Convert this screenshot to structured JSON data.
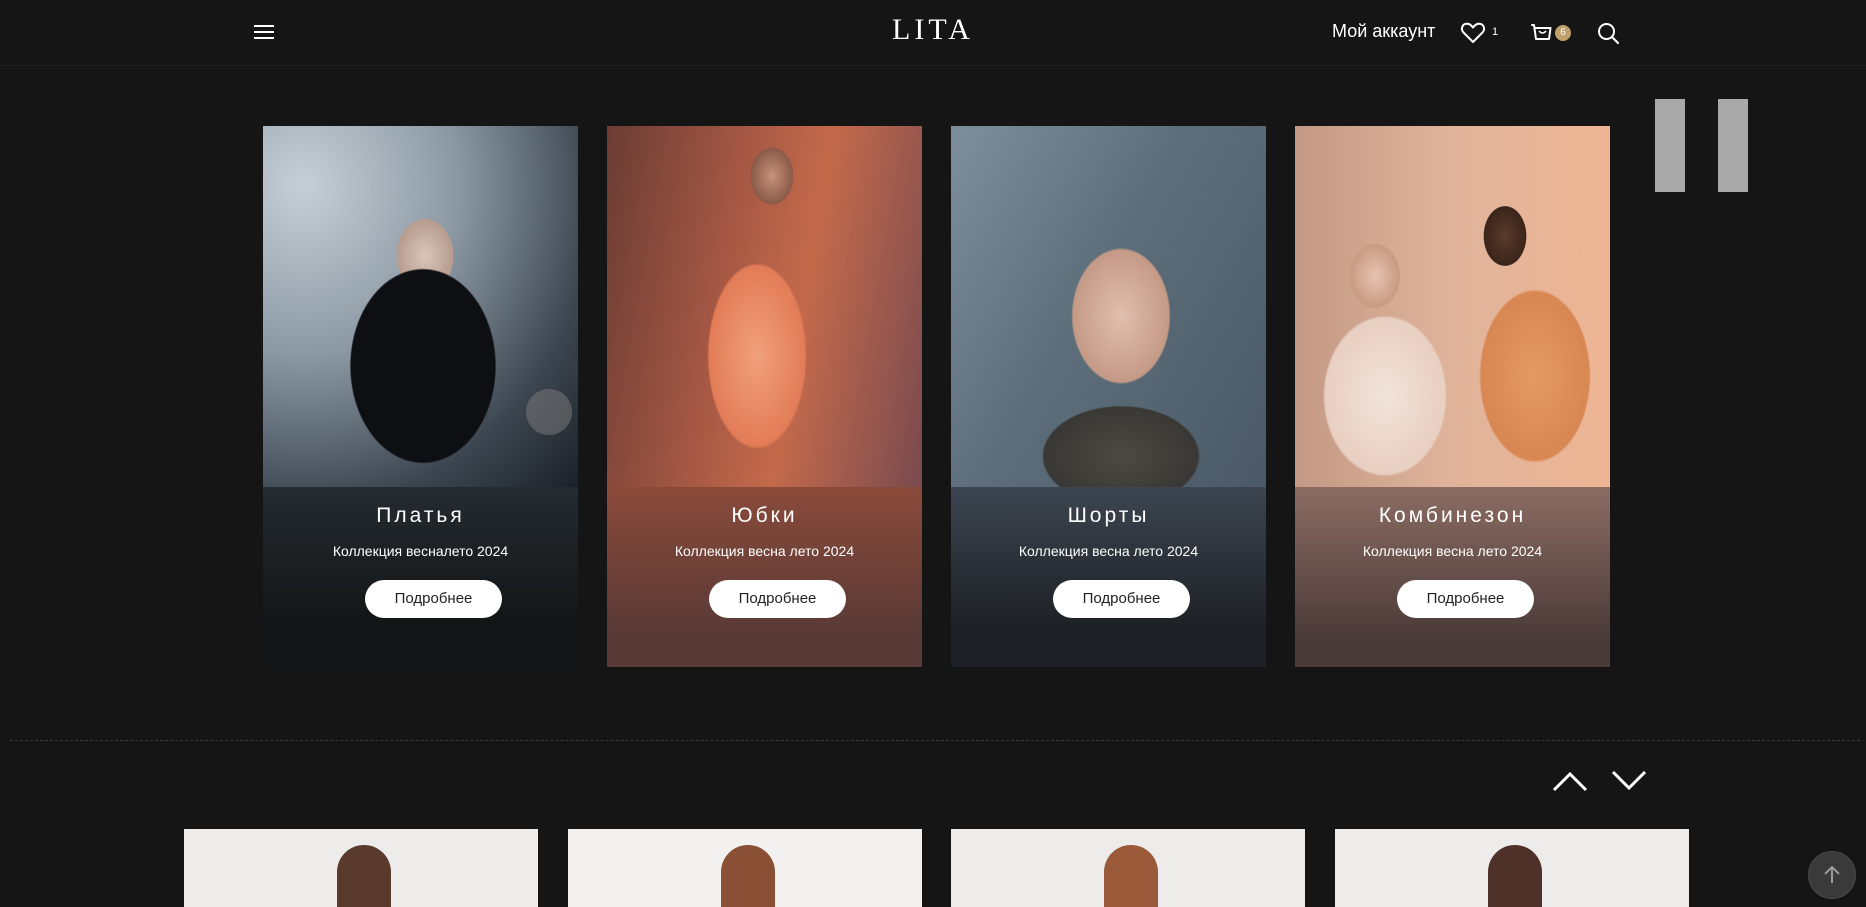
{
  "header": {
    "logo": "LITA",
    "account_label": "Мой аккаунт",
    "wishlist_count": "1",
    "cart_count": "6"
  },
  "categories": [
    {
      "title": "Платья",
      "subtitle": "Коллекция весналето 2024",
      "button": "Подробнее"
    },
    {
      "title": "Юбки",
      "subtitle": "Коллекция весна лето 2024",
      "button": "Подробнее"
    },
    {
      "title": "Шорты",
      "subtitle": "Коллекция весна лето 2024",
      "button": "Подробнее"
    },
    {
      "title": "Комбинезон",
      "subtitle": "Коллекция весна лето 2024",
      "button": "Подробнее"
    }
  ],
  "colors": {
    "background": "#151515",
    "badge": "#bfa06a",
    "button_bg": "#ffffff"
  },
  "icons": [
    "menu-icon",
    "heart-icon",
    "cart-icon",
    "search-icon",
    "chevron-up-icon",
    "chevron-down-icon",
    "arrow-up-icon"
  ]
}
